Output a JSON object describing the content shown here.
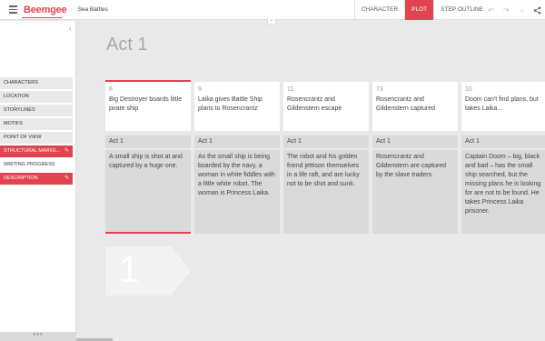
{
  "header": {
    "brand": "Beemgee",
    "project": "Sea Battles",
    "tabs": [
      {
        "label": "CHARACTER",
        "active": false
      },
      {
        "label": "PLOT",
        "active": true
      },
      {
        "label": "STEP OUTLINE",
        "active": false
      }
    ],
    "icons": [
      "undo-icon",
      "redo-icon",
      "ring-icon",
      "share-icon"
    ]
  },
  "sidebar": {
    "items": [
      {
        "label": "CHARACTERS",
        "style": "gray",
        "editable": false
      },
      {
        "label": "LOCATION",
        "style": "gray",
        "editable": false
      },
      {
        "label": "STORYLINES",
        "style": "gray",
        "editable": false
      },
      {
        "label": "MOTIFS",
        "style": "gray",
        "editable": false
      },
      {
        "label": "POINT OF VIEW",
        "style": "gray",
        "editable": false
      },
      {
        "label": "STRUCTURAL MARKE...",
        "style": "red",
        "editable": true
      },
      {
        "label": "WRITING PROGRESS",
        "style": "white",
        "editable": false
      },
      {
        "label": "DESCRIPTION",
        "style": "red",
        "editable": true
      }
    ],
    "footer": "•••"
  },
  "main": {
    "act_title": "Act 1",
    "cards": [
      {
        "num": "8",
        "title": "Big Destroyer boards little pirate ship",
        "act": "Act 1",
        "desc": "A small ship is shot at and captured by a huge one.",
        "active": true
      },
      {
        "num": "9",
        "title": "Laika gives Battle Ship plans to Rosencrantz",
        "act": "Act 1",
        "desc": "As the small ship is being boarded by the navy, a woman in white fiddles with a little white robot. The woman is Princess Laika.",
        "active": false
      },
      {
        "num": "11",
        "title": "Rosencrantz and Gildenstern escape",
        "act": "Act 1",
        "desc": "The robot and his golden friend jettison themselves in a life raft, and are lucky not to be shot and sunk.",
        "active": false
      },
      {
        "num": "73",
        "title": "Rosencrantz and Gildenstern captured",
        "act": "Act 1",
        "desc": "Rosencrantz and Gildenstern are captured by the slave traders.",
        "active": false
      },
      {
        "num": "10",
        "title": "Doom can't find plans, but takes Laika...",
        "act": "Act 1",
        "desc": "Captain Doom – big, black and bad – has the small ship searched, but the missing plans he is looking for are not to be found. He takes Princess Laika prisoner.",
        "active": false
      }
    ],
    "marker_number": "1"
  },
  "colors": {
    "accent": "#e0454f",
    "background": "#e9e9e9"
  }
}
